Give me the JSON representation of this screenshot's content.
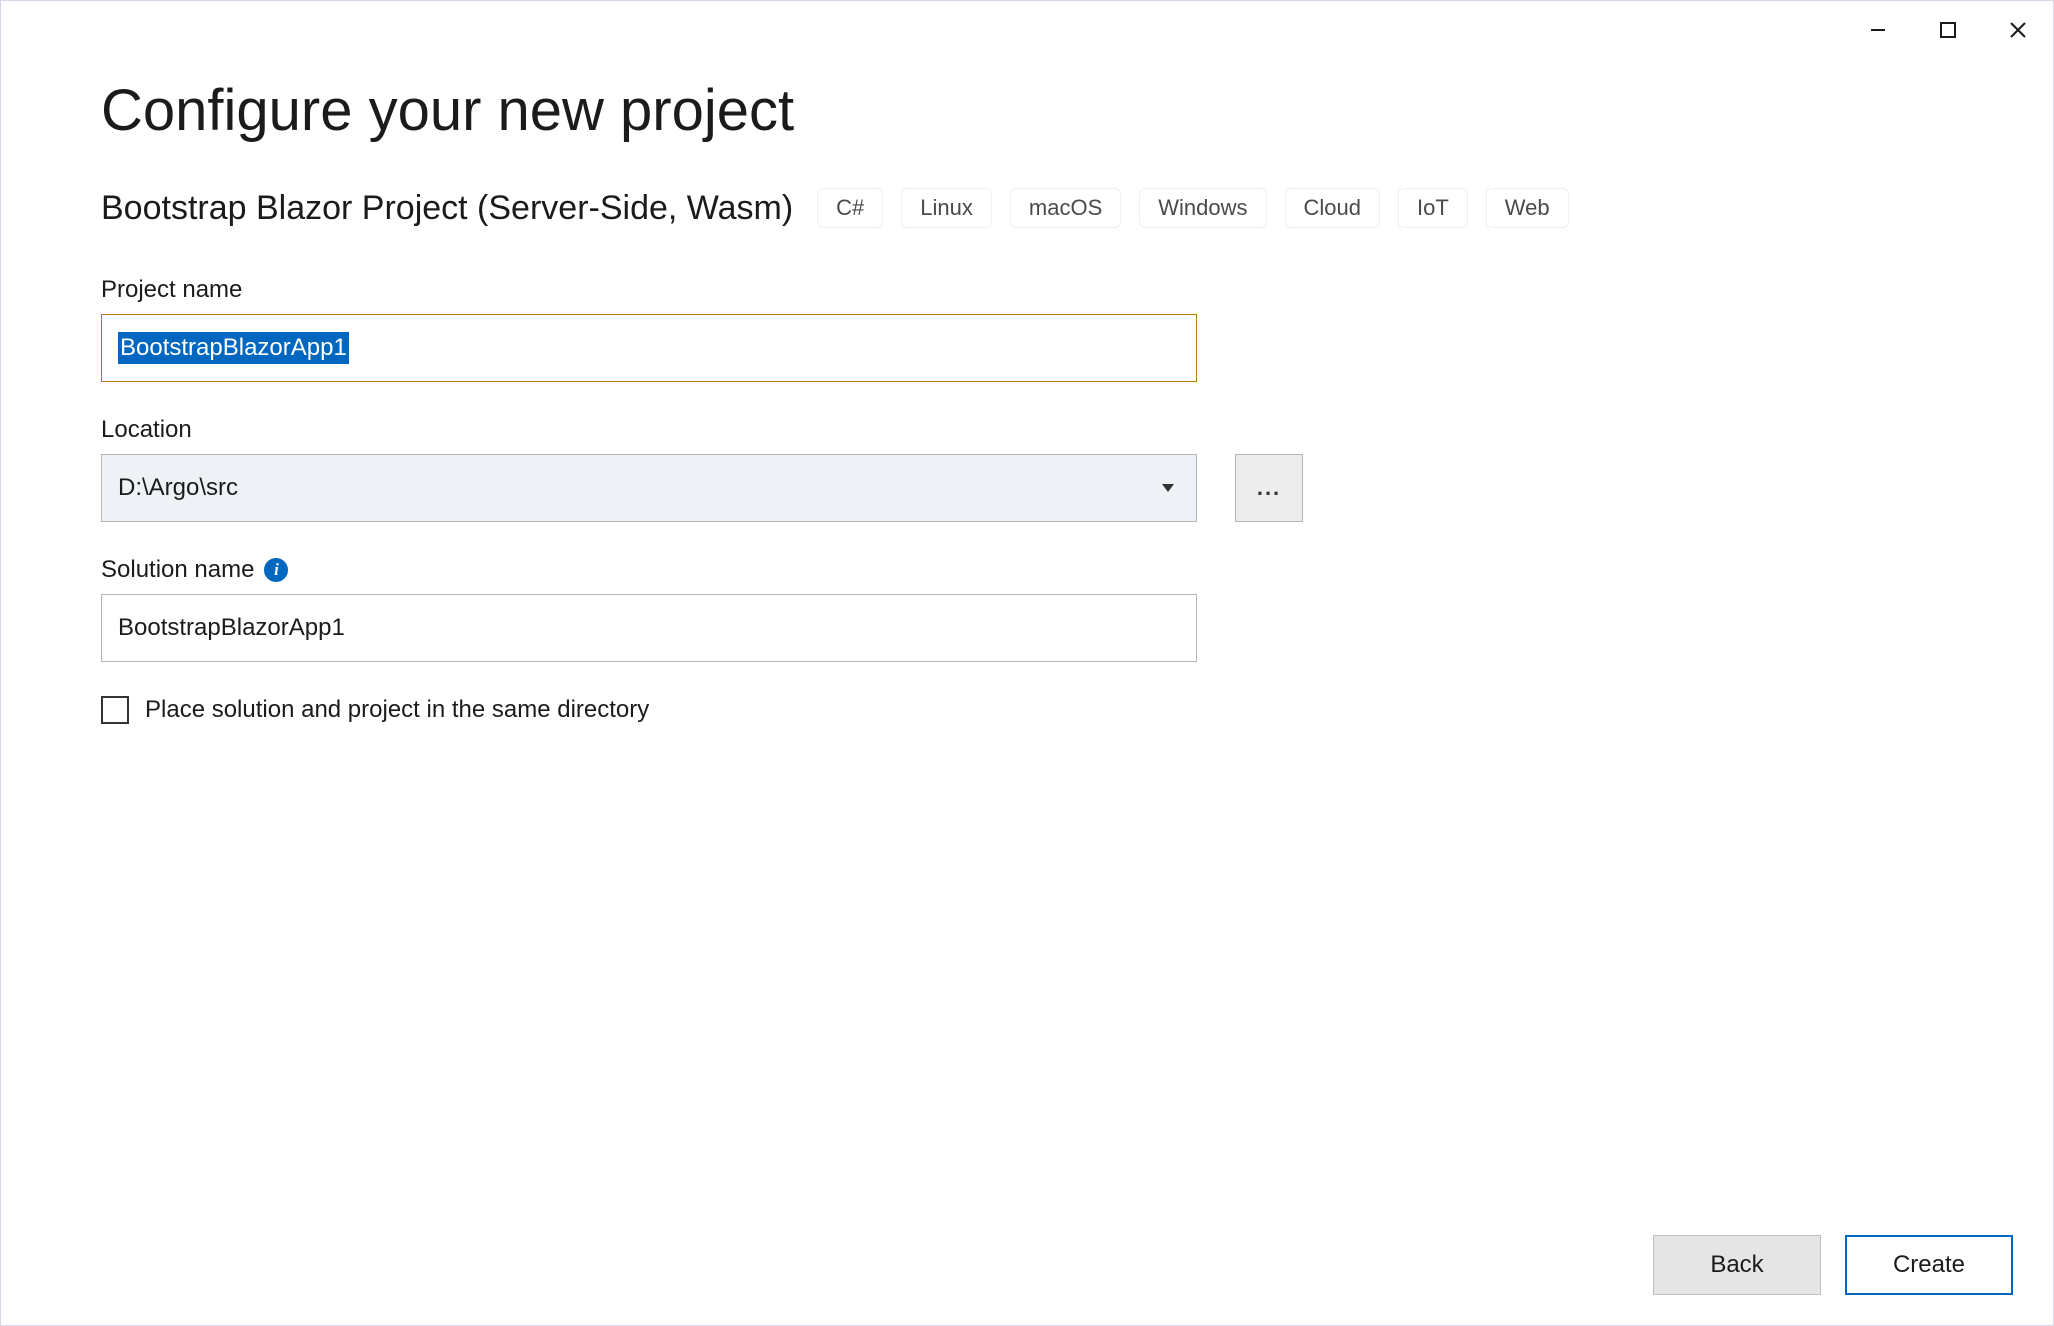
{
  "header": {
    "title": "Configure your new project",
    "subtitle": "Bootstrap Blazor Project (Server-Side, Wasm)",
    "tags": [
      "C#",
      "Linux",
      "macOS",
      "Windows",
      "Cloud",
      "IoT",
      "Web"
    ]
  },
  "fields": {
    "project_name": {
      "label": "Project name",
      "value": "BootstrapBlazorApp1"
    },
    "location": {
      "label": "Location",
      "value": "D:\\Argo\\src",
      "browse_label": "..."
    },
    "solution_name": {
      "label": "Solution name",
      "value": "BootstrapBlazorApp1"
    },
    "same_dir": {
      "label": "Place solution and project in the same directory",
      "checked": false
    }
  },
  "buttons": {
    "back": "Back",
    "create": "Create"
  }
}
